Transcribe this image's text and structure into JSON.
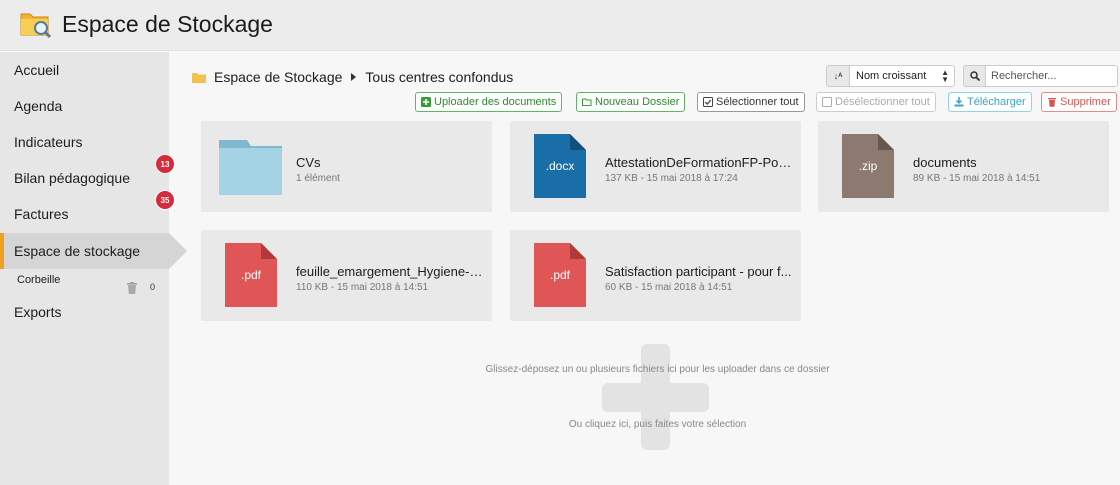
{
  "app": {
    "title": "Espace de Stockage"
  },
  "sidebar": {
    "items": [
      {
        "label": "Accueil"
      },
      {
        "label": "Agenda"
      },
      {
        "label": "Indicateurs"
      },
      {
        "label": "Bilan pédagogique",
        "badge": "13"
      },
      {
        "label": "Factures",
        "badge": "35"
      },
      {
        "label": "Espace de stockage",
        "active": true
      },
      {
        "label": "Exports"
      }
    ],
    "sub_item": {
      "label": "Corbeille",
      "count": "0"
    }
  },
  "breadcrumb": {
    "root": "Espace de Stockage",
    "current": "Tous centres confondus"
  },
  "sort": {
    "selected": "Nom croissant"
  },
  "search": {
    "placeholder": "Rechercher..."
  },
  "toolbar": {
    "upload": "Uploader des documents",
    "new_folder": "Nouveau Dossier",
    "select_all": "Sélectionner tout",
    "deselect_all": "Désélectionner tout",
    "download": "Télécharger",
    "delete": "Supprimer"
  },
  "files": [
    {
      "name": "CVs",
      "meta": "1 élément",
      "kind": "folder"
    },
    {
      "name": "AttestationDeFormationFP-Port...",
      "meta": "137 KB - 15 mai 2018 à 17:24",
      "ext": ".docx",
      "color": "#1a6ea8"
    },
    {
      "name": "documents",
      "meta": "89 KB - 15 mai 2018 à 14:51",
      "ext": ".zip",
      "color": "#8c7a70"
    },
    {
      "name": "feuille_emargement_Hygiene-et...",
      "meta": "110 KB - 15 mai 2018 à 14:51",
      "ext": ".pdf",
      "color": "#e05555"
    },
    {
      "name": "Satisfaction participant - pour f...",
      "meta": "60 KB - 15 mai 2018 à 14:51",
      "ext": ".pdf",
      "color": "#e05555"
    }
  ],
  "dropzone": {
    "text1": "Glissez-déposez un ou plusieurs fichiers ici pour les uploader dans ce dossier",
    "text2": "Ou cliquez ici, puis faites votre sélection"
  },
  "colors": {
    "accent": "#f0a020",
    "badge": "#d42c3a",
    "folder": "#a5d3e6"
  }
}
